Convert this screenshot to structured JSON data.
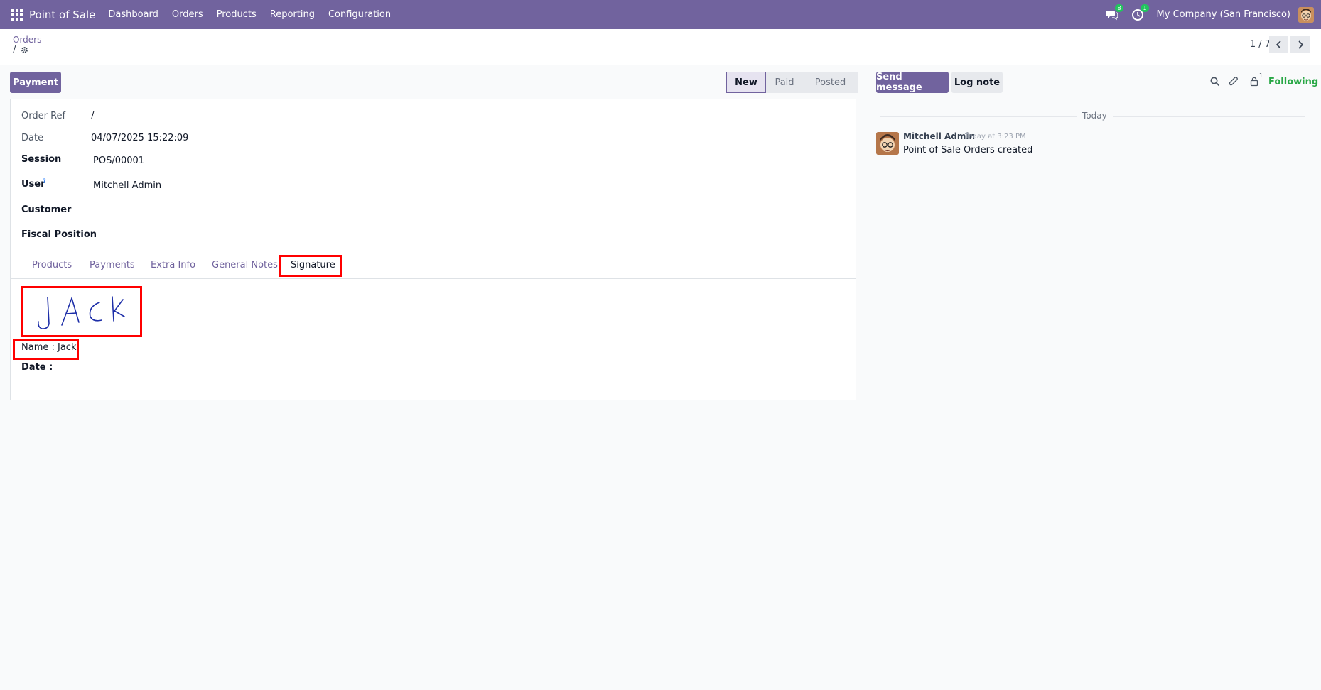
{
  "navbar": {
    "app_name": "Point of Sale",
    "menu": [
      "Dashboard",
      "Orders",
      "Products",
      "Reporting",
      "Configuration"
    ],
    "messages_badge": "8",
    "activities_badge": "1",
    "company": "My Company (San Francisco)"
  },
  "control_panel": {
    "breadcrumb_parent": "Orders",
    "breadcrumb_current": "/",
    "pager": "1 / 7"
  },
  "form": {
    "payment_button": "Payment",
    "statusbar": [
      "New",
      "Paid",
      "Posted"
    ],
    "active_status": "New",
    "fields": {
      "order_ref_label": "Order Ref",
      "order_ref": "/",
      "date_label": "Date",
      "date": "04/07/2025 15:22:09",
      "session_label": "Session",
      "session": "POS/00001",
      "user_label": "User",
      "user_help": "?",
      "user": "Mitchell Admin",
      "customer_label": "Customer",
      "fiscal_position_label": "Fiscal Position"
    },
    "tabs": [
      "Products",
      "Payments",
      "Extra Info",
      "General Notes",
      "Signature"
    ],
    "active_tab": "Signature",
    "signature": {
      "drawn_text": "JACK",
      "name_line": "Name : Jack",
      "date_line": "Date :"
    }
  },
  "chatter": {
    "send_message": "Send message",
    "log_note": "Log note",
    "followers_count": "1",
    "following": "Following",
    "day_separator": "Today",
    "messages": [
      {
        "author": "Mitchell Admin",
        "time": "Today at 3:23 PM",
        "body": "Point of Sale Orders created"
      }
    ]
  },
  "colors": {
    "brand": "#71639e",
    "following": "#28a745",
    "highlight": "#ff0000"
  }
}
